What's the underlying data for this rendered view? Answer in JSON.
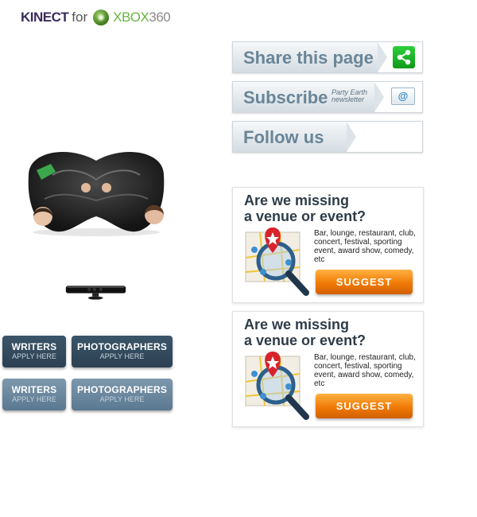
{
  "ad": {
    "brand": "KINECT",
    "for_text": "for",
    "xbox_text": "XBOX",
    "xbox_number": "360"
  },
  "apply_buttons": [
    {
      "title": "WRITERS",
      "subtitle": "APPLY HERE"
    },
    {
      "title": "PHOTOGRAPHERS",
      "subtitle": "APPLY HERE"
    },
    {
      "title": "WRITERS",
      "subtitle": "APPLY HERE"
    },
    {
      "title": "PHOTOGRAPHERS",
      "subtitle": "APPLY HERE"
    }
  ],
  "social": {
    "share_label": "Share this page",
    "subscribe_label": "Subscribe",
    "newsletter_line1": "Party Earth",
    "newsletter_line2": "newsletter",
    "mail_glyph": "@",
    "follow_label": "Follow us"
  },
  "suggest_boxes": [
    {
      "title_line1": "Are we missing",
      "title_line2": "a venue or event?",
      "description": "Bar, lounge, restaurant, club, concert, festival, sporting event, award show, comedy, etc",
      "button_label": "SUGGEST"
    },
    {
      "title_line1": "Are we missing",
      "title_line2": "a venue or event?",
      "description": "Bar, lounge, restaurant, club, concert, festival, sporting event, award show, comedy, etc",
      "button_label": "SUGGEST"
    }
  ],
  "colors": {
    "brand_green": "#6ab43e",
    "apply_dark": "#34495a",
    "apply_light": "#6e8ba1",
    "suggest_orange": "#f07a06",
    "share_green": "#1fb329"
  }
}
